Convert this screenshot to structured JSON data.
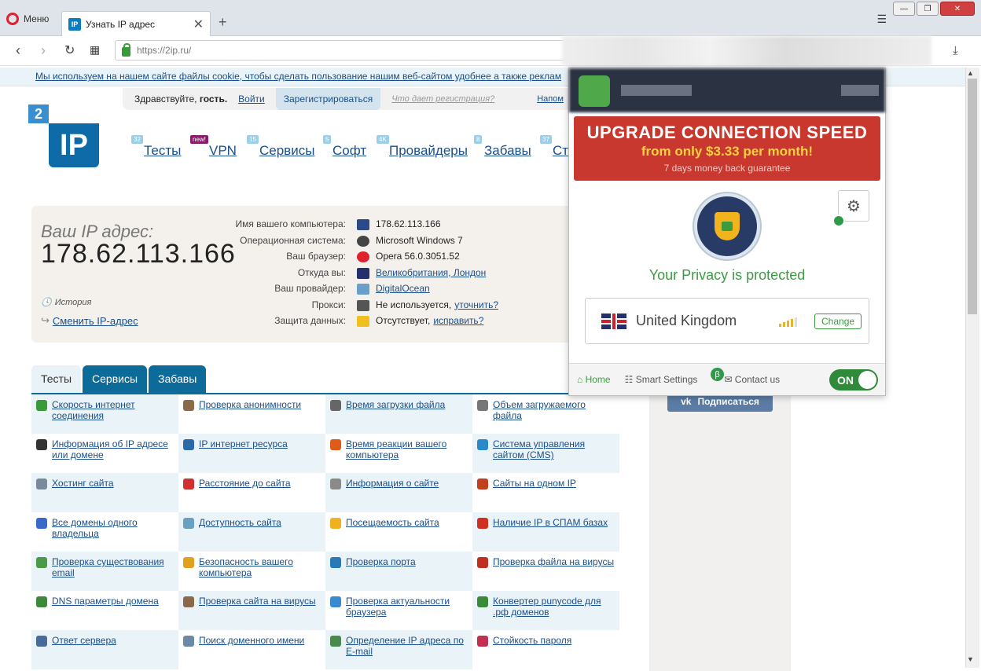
{
  "browser": {
    "menu_label": "Меню",
    "tab_title": "Узнать IP адрес",
    "url": "https://2ip.ru/",
    "colors": {
      "opera_red": "#e0202b"
    }
  },
  "page": {
    "cookie_text": "Мы используем на нашем сайте файлы cookie, чтобы сделать пользование нашим веб-сайтом удобнее а также реклам",
    "greeting": "Здравствуйте,",
    "guest": "гость.",
    "login": "Войти",
    "register": "Зарегистрироваться",
    "what_reg": "Что дает регистрация?",
    "remind": "Напом",
    "logo_small": "2",
    "logo_big": "IP",
    "nav": [
      {
        "label": "Тесты",
        "badge": "32"
      },
      {
        "label": "VPN",
        "badge": "new!"
      },
      {
        "label": "Сервисы",
        "badge": "15"
      },
      {
        "label": "Софт",
        "badge": "5"
      },
      {
        "label": "Провайдеры",
        "badge": "4K"
      },
      {
        "label": "Забавы",
        "badge": "8"
      },
      {
        "label": "Ста",
        "badge": "37"
      }
    ],
    "ip_label": "Ваш IP адрес:",
    "ip_value": "178.62.113.166",
    "history": "История",
    "change_ip": "Сменить IP-адрес",
    "info": [
      {
        "label": "Имя вашего компьютера:",
        "value": "178.62.113.166",
        "icon": "computer-icon"
      },
      {
        "label": "Операционная система:",
        "value": "Microsoft Windows 7",
        "icon": "windows-icon"
      },
      {
        "label": "Ваш браузер:",
        "value": "Opera 56.0.3051.52",
        "icon": "opera-icon"
      },
      {
        "label": "Откуда вы:",
        "value": "Великобритания, Лондон",
        "icon": "uk-flag-icon"
      },
      {
        "label": "Ваш провайдер:",
        "value": "DigitalOcean",
        "icon": "cloud-icon"
      },
      {
        "label": "Прокси:",
        "value": "Не используется,",
        "extra": "уточнить?",
        "icon": "glasses-icon"
      },
      {
        "label": "Защита данных:",
        "value": "Отсутствует,",
        "extra": "исправить?",
        "icon": "warning-icon"
      }
    ],
    "tabs": [
      "Тесты",
      "Сервисы",
      "Забавы"
    ],
    "tests": [
      [
        "Скорость интернет соединения",
        "#3a9a3a"
      ],
      [
        "Проверка анонимности",
        "#8a6a4a"
      ],
      [
        "Время загрузки файла",
        "#666"
      ],
      [
        "Объем загружаемого файла",
        "#777"
      ],
      [
        "Информация об IP адресе или домене",
        "#333"
      ],
      [
        "IP интернет ресурса",
        "#2a6aa8"
      ],
      [
        "Время реакции вашего компьютера",
        "#e05a1a"
      ],
      [
        "Система управления сайтом (CMS)",
        "#2a8ac8"
      ],
      [
        "Хостинг сайта",
        "#7a8a9a"
      ],
      [
        "Расстояние до сайта",
        "#d03030"
      ],
      [
        "Информация о сайте",
        "#8a8a8a"
      ],
      [
        "Сайты на одном IP",
        "#c04020"
      ],
      [
        "Все домены одного владельца",
        "#3a6ac8"
      ],
      [
        "Доступность сайта",
        "#6aa0c0"
      ],
      [
        "Посещаемость сайта",
        "#f0b020"
      ],
      [
        "Наличие IP в СПАМ базах",
        "#d03020"
      ],
      [
        "Проверка существования email",
        "#4a9a4a"
      ],
      [
        "Безопасность вашего компьютера",
        "#e0a020"
      ],
      [
        "Проверка порта",
        "#2a7ab8"
      ],
      [
        "Проверка файла на вирусы",
        "#c03020"
      ],
      [
        "DNS параметры домена",
        "#3a8a3a"
      ],
      [
        "Проверка сайта на вирусы",
        "#8a6a4a"
      ],
      [
        "Проверка актуальности браузера",
        "#3a8ad0"
      ],
      [
        "Конвертер punycode для .рф доменов",
        "#3a8a3a"
      ],
      [
        "Ответ сервера",
        "#4a6a9a"
      ],
      [
        "Поиск доменного имени",
        "#6a8aa8"
      ],
      [
        "Определение IP адреса по E-mail",
        "#4a8a4a"
      ],
      [
        "Стойкость пароля",
        "#c03050"
      ]
    ],
    "vk": "Подписаться"
  },
  "vpn": {
    "banner_title": "UPGRADE CONNECTION SPEED",
    "banner_price": "from only $3.33 per month!",
    "banner_note": "7 days money back guarantee",
    "status": "Your Privacy is protected",
    "location": "United Kingdom",
    "change": "Change",
    "footer": {
      "home": "Home",
      "smart": "Smart Settings",
      "beta": "β",
      "contact": "Contact us"
    },
    "toggle": "ON",
    "colors": {
      "banner": "#c9382f",
      "green": "#3d9a44",
      "price": "#ffd23f"
    }
  }
}
